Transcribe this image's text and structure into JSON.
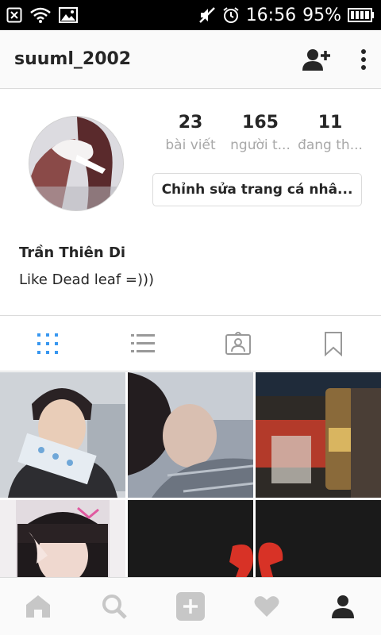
{
  "status_bar": {
    "time": "16:56",
    "battery": "95%"
  },
  "header": {
    "username": "suuml_2002"
  },
  "profile": {
    "stats": [
      {
        "number": "23",
        "label": "bài viết"
      },
      {
        "number": "165",
        "label": "người t..."
      },
      {
        "number": "11",
        "label": "đang th..."
      }
    ],
    "edit_button": "Chỉnh sửa trang cá nhâ...",
    "full_name": "Trần Thiên Di",
    "bio": "Like Dead leaf =)))"
  },
  "tabs": {
    "icons": [
      "grid-icon",
      "list-icon",
      "tagged-icon",
      "bookmark-icon"
    ],
    "active": "grid-icon",
    "active_color": "#3897f0",
    "inactive_color": "#999999"
  },
  "bottom_nav": {
    "icons": [
      "home-icon",
      "search-icon",
      "add-post-icon",
      "heart-icon",
      "profile-icon"
    ],
    "active": "profile-icon"
  }
}
